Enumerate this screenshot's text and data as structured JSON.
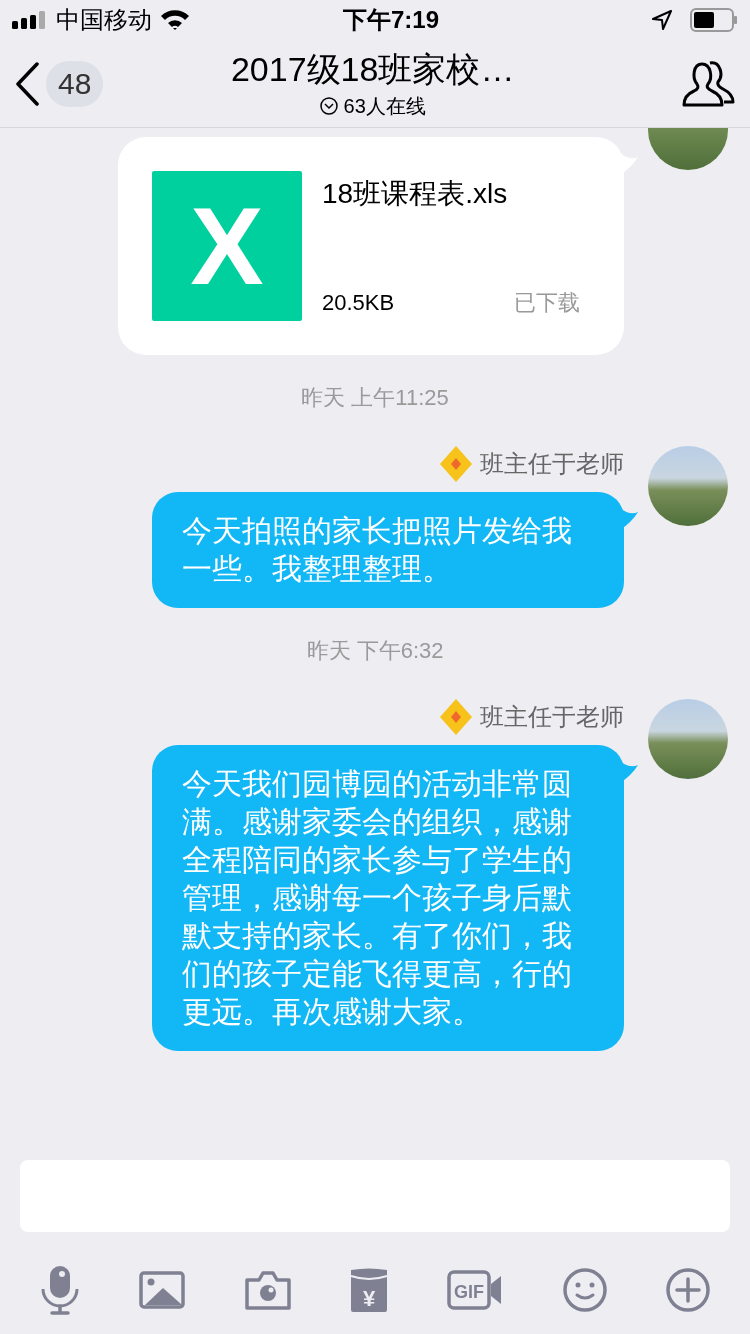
{
  "status_bar": {
    "carrier": "中国移动",
    "time": "下午7:19"
  },
  "header": {
    "back_count": "48",
    "title": "2017级18班家校…",
    "online": "63人在线"
  },
  "messages": [
    {
      "kind": "file",
      "file_name": "18班课程表.xls",
      "file_icon": "X",
      "size": "20.5KB",
      "status": "已下载"
    },
    {
      "kind": "time",
      "text": "昨天 上午11:25"
    },
    {
      "kind": "text",
      "sender": "班主任于老师",
      "text": "今天拍照的家长把照片发给我一些。我整理整理。"
    },
    {
      "kind": "time",
      "text": "昨天 下午6:32"
    },
    {
      "kind": "text",
      "sender": "班主任于老师",
      "text": "今天我们园博园的活动非常圆满。感谢家委会的组织，感谢全程陪同的家长参与了学生的管理，感谢每一个孩子身后默默支持的家长。有了你们，我们的孩子定能飞得更高，行的更远。再次感谢大家。"
    }
  ],
  "toolbar": {
    "red_packet_label": "¥",
    "gif_label": "GIF"
  }
}
